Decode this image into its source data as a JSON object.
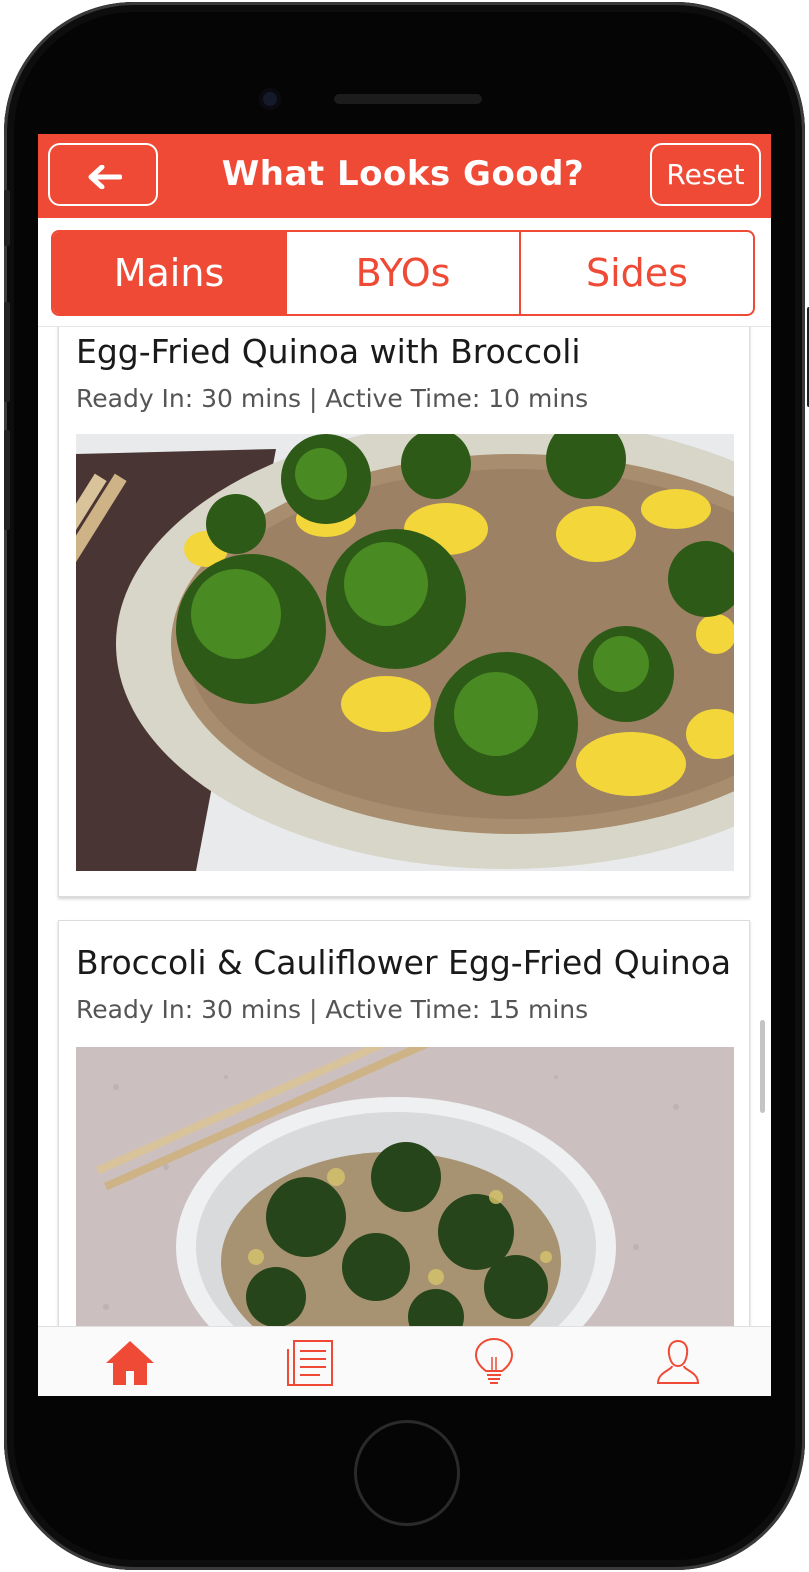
{
  "header": {
    "title": "What Looks Good?",
    "reset_label": "Reset",
    "back_icon": "arrow-left-icon"
  },
  "tabs": [
    {
      "label": "Mains",
      "active": true
    },
    {
      "label": "BYOs",
      "active": false
    },
    {
      "label": "Sides",
      "active": false
    }
  ],
  "recipes": [
    {
      "title": "Egg-Fried Quinoa with Broccoli",
      "meta": "Ready In: 30 mins | Active Time: 10 mins"
    },
    {
      "title": "Broccoli & Cauliflower Egg-Fried Quinoa",
      "meta": "Ready In: 30 mins | Active Time: 15 mins"
    }
  ],
  "bottom_nav": {
    "items": [
      "home-icon",
      "list-icon",
      "lightbulb-icon",
      "user-icon"
    ],
    "active": "home-icon"
  },
  "colors": {
    "accent": "#ef4a36",
    "background": "#ffffff",
    "text": "#1a1a1a",
    "muted_text": "#555555"
  }
}
